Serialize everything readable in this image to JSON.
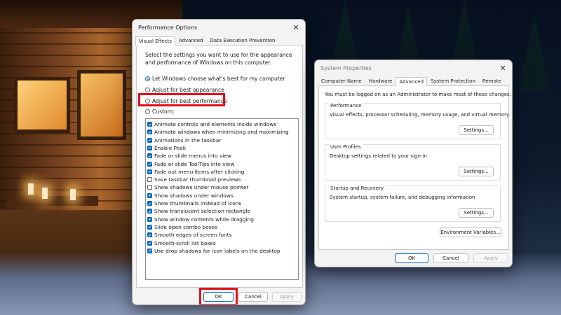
{
  "performance_options": {
    "title": "Performance Options",
    "tabs": [
      "Visual Effects",
      "Advanced",
      "Data Execution Prevention"
    ],
    "active_tab": "Visual Effects",
    "intro": "Select the settings you want to use for the appearance and performance of Windows on this computer.",
    "radios": [
      {
        "label": "Let Windows choose what's best for my computer",
        "selected": true
      },
      {
        "label": "Adjust for best appearance",
        "selected": false
      },
      {
        "label": "Adjust for best performance",
        "selected": false
      },
      {
        "label": "Custom:",
        "selected": false
      }
    ],
    "checkboxes": [
      {
        "label": "Animate controls and elements inside windows",
        "checked": true
      },
      {
        "label": "Animate windows when minimizing and maximizing",
        "checked": true
      },
      {
        "label": "Animations in the taskbar",
        "checked": true
      },
      {
        "label": "Enable Peek",
        "checked": true
      },
      {
        "label": "Fade or slide menus into view",
        "checked": true
      },
      {
        "label": "Fade or slide ToolTips into view",
        "checked": true
      },
      {
        "label": "Fade out menu items after clicking",
        "checked": true
      },
      {
        "label": "Save taskbar thumbnail previews",
        "checked": false
      },
      {
        "label": "Show shadows under mouse pointer",
        "checked": false
      },
      {
        "label": "Show shadows under windows",
        "checked": true
      },
      {
        "label": "Show thumbnails instead of icons",
        "checked": true
      },
      {
        "label": "Show translucent selection rectangle",
        "checked": true
      },
      {
        "label": "Show window contents while dragging",
        "checked": true
      },
      {
        "label": "Slide open combo boxes",
        "checked": true
      },
      {
        "label": "Smooth edges of screen fonts",
        "checked": true
      },
      {
        "label": "Smooth-scroll list boxes",
        "checked": true
      },
      {
        "label": "Use drop shadows for icon labels on the desktop",
        "checked": true
      }
    ],
    "buttons": {
      "ok": "OK",
      "cancel": "Cancel",
      "apply": "Apply"
    }
  },
  "system_properties": {
    "title": "System Properties",
    "tabs": [
      "Computer Name",
      "Hardware",
      "Advanced",
      "System Protection",
      "Remote"
    ],
    "active_tab": "Advanced",
    "notice": "You must be logged on as an Administrator to make most of these changes.",
    "groups": [
      {
        "label": "Performance",
        "description": "Visual effects, processor scheduling, memory usage, and virtual memory",
        "button": "Settings..."
      },
      {
        "label": "User Profiles",
        "description": "Desktop settings related to your sign-in",
        "button": "Settings..."
      },
      {
        "label": "Startup and Recovery",
        "description": "System startup, system failure, and debugging information",
        "button": "Settings..."
      }
    ],
    "env_button": "Environment Variables...",
    "buttons": {
      "ok": "OK",
      "cancel": "Cancel",
      "apply": "Apply"
    }
  },
  "colors": {
    "accent": "#0067c0",
    "highlight": "#e3101a"
  }
}
